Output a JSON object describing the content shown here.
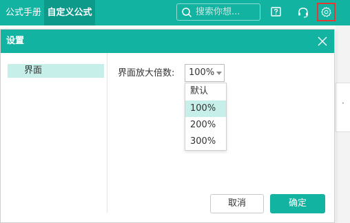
{
  "topbar": {
    "tab_manual": "公式手册",
    "tab_custom": "自定义公式",
    "search_placeholder": "搜索你想...",
    "icons": [
      "help-icon",
      "headset-icon",
      "gear-icon"
    ]
  },
  "colors": {
    "primary": "#13b3a1",
    "primary_dark": "#0e9a8b",
    "selected": "#c7efe9",
    "highlight": "#e53935"
  },
  "dialog": {
    "title": "设置",
    "sidebar": [
      {
        "label": "界面"
      }
    ],
    "zoom_label": "界面放大倍数:",
    "zoom_value": "100%",
    "options": [
      {
        "label": "默认"
      },
      {
        "label": "100%"
      },
      {
        "label": "200%"
      },
      {
        "label": "300%"
      }
    ],
    "cancel": "取消",
    "confirm": "确定"
  }
}
